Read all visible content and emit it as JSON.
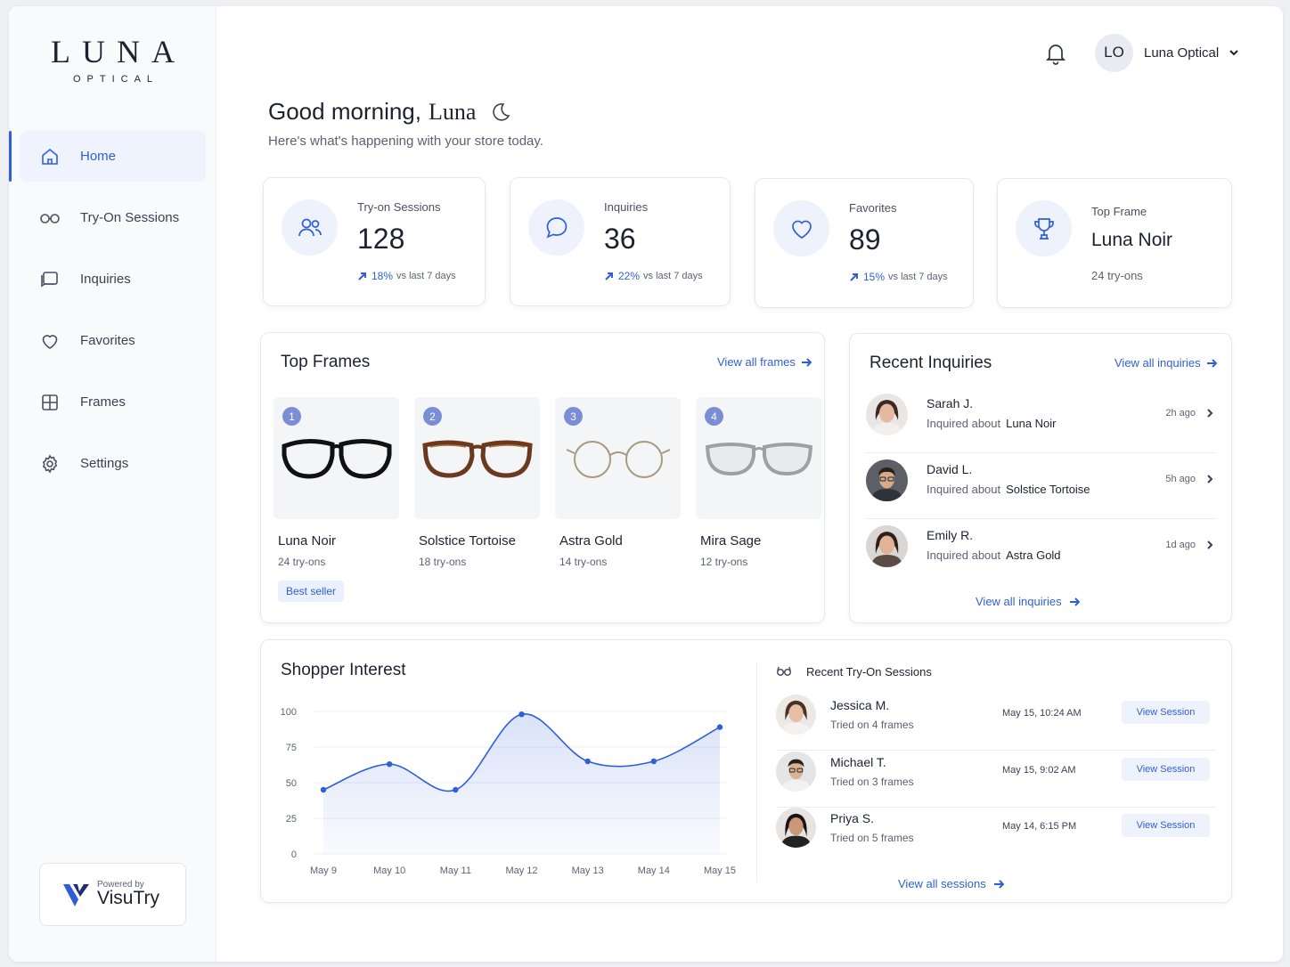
{
  "brand": {
    "logo_main": "LUNA",
    "logo_sub": "OPTICAL"
  },
  "sidebar": {
    "items": [
      {
        "label": "Home",
        "icon": "home-icon"
      },
      {
        "label": "Try-On Sessions",
        "icon": "glasses-icon"
      },
      {
        "label": "Inquiries",
        "icon": "chat-icon"
      },
      {
        "label": "Favorites",
        "icon": "heart-icon"
      },
      {
        "label": "Frames",
        "icon": "grid-icon"
      },
      {
        "label": "Settings",
        "icon": "gear-icon"
      }
    ],
    "active": "Home",
    "powered_by": "Powered by",
    "powered_brand": "VisuTry"
  },
  "header": {
    "avatar_initials": "LO",
    "account_name": "Luna Optical"
  },
  "greeting": {
    "prefix": "Good morning,",
    "name": "Luna",
    "subtitle": "Here's what's happening with your store today."
  },
  "stats": [
    {
      "label": "Try-on Sessions",
      "value": "128",
      "pct": "18%",
      "note": "vs last 7 days"
    },
    {
      "label": "Inquiries",
      "value": "36",
      "pct": "22%",
      "note": "vs last 7 days"
    },
    {
      "label": "Favorites",
      "value": "89",
      "pct": "15%",
      "note": "vs last 7 days"
    },
    {
      "label": "Top Frame",
      "value": "Luna Noir",
      "sub": "24 try-ons"
    }
  ],
  "top_frames": {
    "title": "Top Frames",
    "link": "View all frames",
    "items": [
      {
        "rank": "1",
        "name": "Luna Noir",
        "tries": "24 try-ons",
        "badge": "Best seller"
      },
      {
        "rank": "2",
        "name": "Solstice Tortoise",
        "tries": "18 try-ons"
      },
      {
        "rank": "3",
        "name": "Astra Gold",
        "tries": "14 try-ons"
      },
      {
        "rank": "4",
        "name": "Mira Sage",
        "tries": "12 try-ons"
      }
    ]
  },
  "recent_inquiries": {
    "title": "Recent Inquiries",
    "link": "View all inquiries",
    "footer_link": "View all inquiries",
    "about_prefix": "Inquired about",
    "items": [
      {
        "name": "Sarah J.",
        "frame": "Luna Noir",
        "time": "2h ago"
      },
      {
        "name": "David L.",
        "frame": "Solstice Tortoise",
        "time": "5h ago"
      },
      {
        "name": "Emily R.",
        "frame": "Astra Gold",
        "time": "1d ago"
      }
    ]
  },
  "shopper_interest": {
    "title": "Shopper Interest"
  },
  "chart_data": {
    "type": "area",
    "title": "Shopper Interest",
    "categories": [
      "May 9",
      "May 10",
      "May 11",
      "May 12",
      "May 13",
      "May 14",
      "May 15"
    ],
    "values": [
      45,
      63,
      45,
      98,
      65,
      65,
      89
    ],
    "ylim": [
      0,
      100
    ],
    "yticks": [
      "100",
      "75",
      "50",
      "25",
      "0"
    ],
    "grid": true,
    "color": "#2f5fd8"
  },
  "recent_sessions": {
    "title": "Recent Try-On Sessions",
    "button_label": "View Session",
    "footer_link": "View all sessions",
    "items": [
      {
        "name": "Jessica M.",
        "tried": "Tried on 4 frames",
        "date": "May 15, 10:24 AM"
      },
      {
        "name": "Michael T.",
        "tried": "Tried on 3 frames",
        "date": "May 15, 9:02 AM"
      },
      {
        "name": "Priya S.",
        "tried": "Tried on 5 frames",
        "date": "May 14, 6:15 PM"
      }
    ]
  },
  "colors": {
    "accent": "#2f5fd8",
    "accent_soft": "#eef2fd",
    "rank_badge": "#7a8ed6"
  }
}
